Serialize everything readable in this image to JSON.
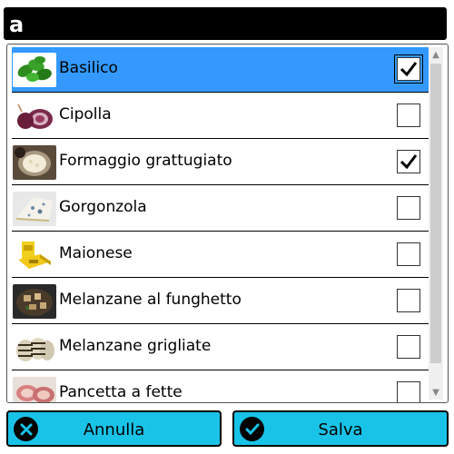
{
  "search": {
    "value": "a"
  },
  "list": {
    "items": [
      {
        "label": "Basilico",
        "checked": true,
        "selected": true,
        "icon": "basil-photo"
      },
      {
        "label": "Cipolla",
        "checked": false,
        "selected": false,
        "icon": "onion-photo"
      },
      {
        "label": "Formaggio grattugiato",
        "checked": true,
        "selected": false,
        "icon": "grated-cheese-photo"
      },
      {
        "label": "Gorgonzola",
        "checked": false,
        "selected": false,
        "icon": "gorgonzola-photo"
      },
      {
        "label": "Maionese",
        "checked": false,
        "selected": false,
        "icon": "mayonnaise-photo"
      },
      {
        "label": "Melanzane al funghetto",
        "checked": false,
        "selected": false,
        "icon": "eggplant-funghetto-photo"
      },
      {
        "label": "Melanzane grigliate",
        "checked": false,
        "selected": false,
        "icon": "grilled-eggplant-photo"
      },
      {
        "label": "Pancetta a fette",
        "checked": false,
        "selected": false,
        "icon": "sliced-pancetta-photo"
      }
    ]
  },
  "buttons": {
    "cancel_label": "Annulla",
    "save_label": "Salva"
  },
  "colors": {
    "selected_row": "#3399ff",
    "button_bg": "#19c3e8",
    "search_bg": "#000000"
  }
}
